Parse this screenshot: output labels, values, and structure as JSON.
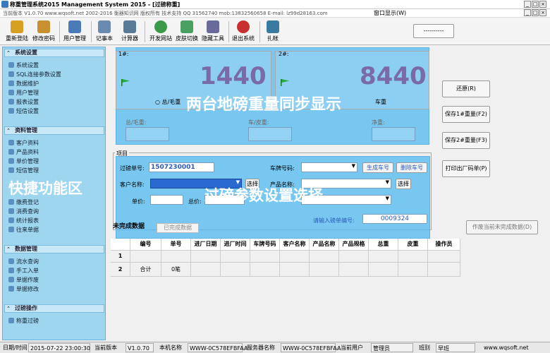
{
  "window": {
    "title": "称重管理系统2015 Management System 2015 - [过磅称重]",
    "controls": [
      "_",
      "□",
      "×"
    ],
    "inner_controls": [
      "_",
      "□",
      "×"
    ]
  },
  "menubar": {
    "info": "当前版本 V1.0.70   www.wqsoft.net 2002-2016 衡器知识网 版权所有 技术支持 QQ 31562740 mob:13832560658  E-mail: lz99d28163.com",
    "window_menu": "窗口显示(W)"
  },
  "toolbar": {
    "items": [
      {
        "label": "重新登陆",
        "icon": "key-icon",
        "color": "#d8a020"
      },
      {
        "label": "修改密码",
        "icon": "lock-icon",
        "color": "#c89030"
      },
      {
        "label": "用户管理",
        "icon": "users-icon",
        "color": "#4a7ab8"
      },
      {
        "label": "记事本",
        "icon": "notepad-icon",
        "color": "#6a8ab0"
      },
      {
        "label": "计算器",
        "icon": "calculator-icon",
        "color": "#5a7a9a"
      },
      {
        "label": "开发网站",
        "icon": "globe-icon",
        "color": "#3a9a4a"
      },
      {
        "label": "皮肤切换",
        "icon": "skin-icon",
        "color": "#4aa060"
      },
      {
        "label": "隐藏工具",
        "icon": "tools-icon",
        "color": "#6a6a9a"
      },
      {
        "label": "退出系统",
        "icon": "exit-icon",
        "color": "#c83030"
      },
      {
        "label": "扎帐",
        "icon": "settle-icon",
        "color": "#3a7aa0"
      }
    ],
    "blank_button": "----------"
  },
  "overlays": {
    "sidebar_caption": "快捷功能区",
    "scales_caption": "两台地磅重量同步显示",
    "params_caption": "过磅参数设置选择"
  },
  "sidebar": {
    "sections": [
      {
        "title": "系统设置",
        "items": [
          "系统设置",
          "SQL连接参数设置",
          "数据维护",
          "用户管理",
          "报表设置",
          "短信设置"
        ]
      },
      {
        "title": "资料管理",
        "items": [
          "客户资料",
          "产品资料",
          "单价管理",
          "短信管理",
          "缴费登记",
          "消费查询",
          "统计报表",
          "往来单据"
        ]
      },
      {
        "title": "数据管理",
        "items": [
          "流水查询",
          "手工入单",
          "单据作废",
          "单据修改"
        ]
      },
      {
        "title": "过磅操作",
        "items": [
          "称重过磅"
        ]
      }
    ]
  },
  "scale1": {
    "label": "1#:",
    "weight": "1440",
    "radio_label": "总/毛重",
    "radio2_label": "重"
  },
  "scale2": {
    "label": "2#:",
    "weight": "8440",
    "radio_label": "车重"
  },
  "weights": {
    "gross_label": "总/毛重:",
    "tare_label": "车/皮重:",
    "net_label": "净重:"
  },
  "params": {
    "group_label": "项目",
    "ticket_label": "过磅单号:",
    "ticket_value": "1507230001",
    "plate_label": "车牌号码:",
    "gen_plate_button": "生成车号",
    "del_plate_button": "删除车号",
    "customer_label": "客户名称:",
    "choose_button": "选择",
    "product_label": "产品名称:",
    "choose2_button": "选择",
    "price_label": "单价:",
    "amount_label": "总价:",
    "input_ticket_hint": "请输入磅单编号:",
    "input_ticket_value": "0009324"
  },
  "tabs": {
    "incomplete": "未完成数据",
    "completed": "已完成数据"
  },
  "right_buttons": {
    "restore": "还原(R)",
    "save1": "保存1#重量(F2)",
    "save2": "保存2#重量(F3)",
    "print": "打印出厂码单(P)",
    "void": "作废当前未完成数据(D)"
  },
  "grid": {
    "columns": [
      "编号",
      "单号",
      "进厂日期",
      "进厂时间",
      "车牌号码",
      "客户名称",
      "产品名称",
      "产品规格",
      "总重",
      "皮重",
      "操作员"
    ],
    "rows": [
      {
        "num": "1",
        "cells": [
          "",
          "",
          "",
          "",
          "",
          "",
          "",
          "",
          "",
          "",
          ""
        ]
      },
      {
        "num": "2",
        "cells": [
          "合计",
          "0笔",
          "",
          "",
          "",
          "",
          "",
          "",
          "",
          "",
          ""
        ]
      }
    ]
  },
  "statusbar": {
    "datetime_label": "日期/时间",
    "datetime_value": "2015-07-22 23:00:30",
    "version_label": "当前版本",
    "version_value": "V1.0.70",
    "machine_label": "本机名称",
    "machine_value": "WWW-0C578EFBFAA",
    "server_label": "服务器名称",
    "server_value": "WWW-0C578EFBFAA",
    "user_label": "当前用户",
    "user_value": "管理员",
    "shift_label": "班别",
    "shift_value": "早班",
    "site": "www.wqsoft.net"
  }
}
